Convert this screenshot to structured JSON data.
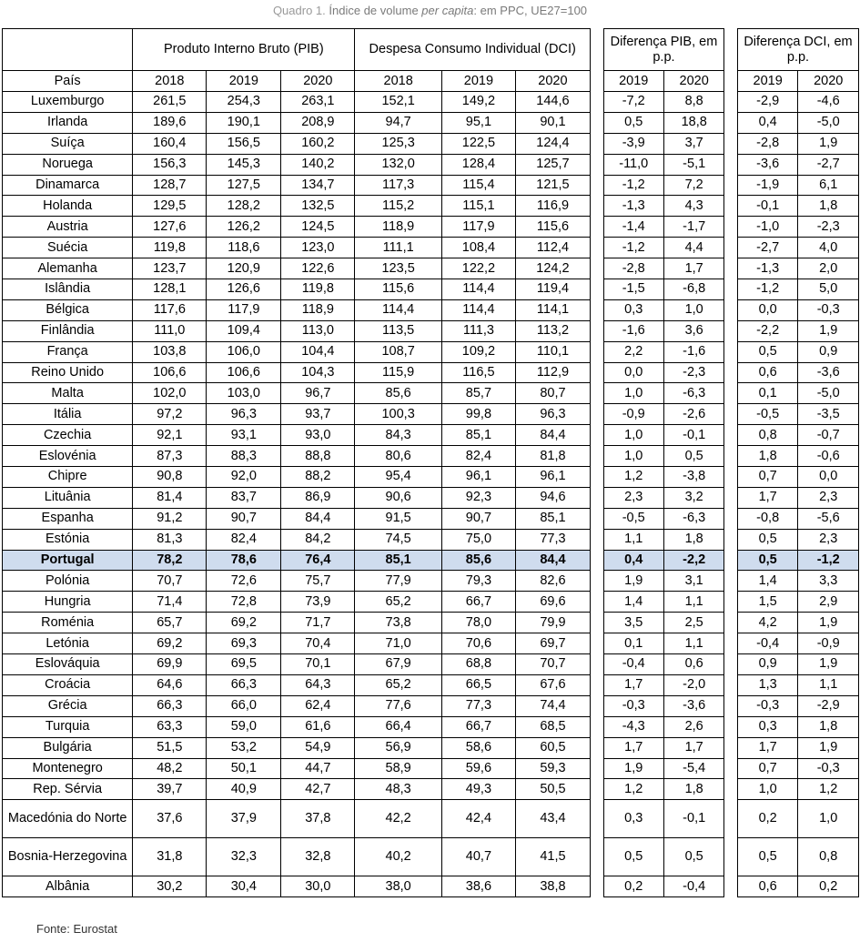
{
  "caption": {
    "label": "Quadro 1.",
    "text_a": "Índice de volume",
    "text_italic": "per capita",
    "text_b": ": em PPC, UE27=100"
  },
  "headers": {
    "pib": "Produto Interno Bruto (PIB)",
    "dci": "Despesa Consumo Individual (DCI)",
    "diff_pib": "Diferença PIB, em p.p.",
    "diff_dci": "Diferença DCI, em p.p.",
    "pais": "País",
    "y2018": "2018",
    "y2019": "2019",
    "y2020": "2020"
  },
  "rows": [
    [
      "Luxemburgo",
      "261,5",
      "254,3",
      "263,1",
      "152,1",
      "149,2",
      "144,6",
      "-7,2",
      "8,8",
      "-2,9",
      "-4,6"
    ],
    [
      "Irlanda",
      "189,6",
      "190,1",
      "208,9",
      "94,7",
      "95,1",
      "90,1",
      "0,5",
      "18,8",
      "0,4",
      "-5,0"
    ],
    [
      "Suíça",
      "160,4",
      "156,5",
      "160,2",
      "125,3",
      "122,5",
      "124,4",
      "-3,9",
      "3,7",
      "-2,8",
      "1,9"
    ],
    [
      "Noruega",
      "156,3",
      "145,3",
      "140,2",
      "132,0",
      "128,4",
      "125,7",
      "-11,0",
      "-5,1",
      "-3,6",
      "-2,7"
    ],
    [
      "Dinamarca",
      "128,7",
      "127,5",
      "134,7",
      "117,3",
      "115,4",
      "121,5",
      "-1,2",
      "7,2",
      "-1,9",
      "6,1"
    ],
    [
      "Holanda",
      "129,5",
      "128,2",
      "132,5",
      "115,2",
      "115,1",
      "116,9",
      "-1,3",
      "4,3",
      "-0,1",
      "1,8"
    ],
    [
      "Austria",
      "127,6",
      "126,2",
      "124,5",
      "118,9",
      "117,9",
      "115,6",
      "-1,4",
      "-1,7",
      "-1,0",
      "-2,3"
    ],
    [
      "Suécia",
      "119,8",
      "118,6",
      "123,0",
      "111,1",
      "108,4",
      "112,4",
      "-1,2",
      "4,4",
      "-2,7",
      "4,0"
    ],
    [
      "Alemanha",
      "123,7",
      "120,9",
      "122,6",
      "123,5",
      "122,2",
      "124,2",
      "-2,8",
      "1,7",
      "-1,3",
      "2,0"
    ],
    [
      "Islândia",
      "128,1",
      "126,6",
      "119,8",
      "115,6",
      "114,4",
      "119,4",
      "-1,5",
      "-6,8",
      "-1,2",
      "5,0"
    ],
    [
      "Bélgica",
      "117,6",
      "117,9",
      "118,9",
      "114,4",
      "114,4",
      "114,1",
      "0,3",
      "1,0",
      "0,0",
      "-0,3"
    ],
    [
      "Finlândia",
      "111,0",
      "109,4",
      "113,0",
      "113,5",
      "111,3",
      "113,2",
      "-1,6",
      "3,6",
      "-2,2",
      "1,9"
    ],
    [
      "França",
      "103,8",
      "106,0",
      "104,4",
      "108,7",
      "109,2",
      "110,1",
      "2,2",
      "-1,6",
      "0,5",
      "0,9"
    ],
    [
      "Reino Unido",
      "106,6",
      "106,6",
      "104,3",
      "115,9",
      "116,5",
      "112,9",
      "0,0",
      "-2,3",
      "0,6",
      "-3,6"
    ],
    [
      "Malta",
      "102,0",
      "103,0",
      "96,7",
      "85,6",
      "85,7",
      "80,7",
      "1,0",
      "-6,3",
      "0,1",
      "-5,0"
    ],
    [
      "Itália",
      "97,2",
      "96,3",
      "93,7",
      "100,3",
      "99,8",
      "96,3",
      "-0,9",
      "-2,6",
      "-0,5",
      "-3,5"
    ],
    [
      "Czechia",
      "92,1",
      "93,1",
      "93,0",
      "84,3",
      "85,1",
      "84,4",
      "1,0",
      "-0,1",
      "0,8",
      "-0,7"
    ],
    [
      "Eslovénia",
      "87,3",
      "88,3",
      "88,8",
      "80,6",
      "82,4",
      "81,8",
      "1,0",
      "0,5",
      "1,8",
      "-0,6"
    ],
    [
      "Chipre",
      "90,8",
      "92,0",
      "88,2",
      "95,4",
      "96,1",
      "96,1",
      "1,2",
      "-3,8",
      "0,7",
      "0,0"
    ],
    [
      "Lituânia",
      "81,4",
      "83,7",
      "86,9",
      "90,6",
      "92,3",
      "94,6",
      "2,3",
      "3,2",
      "1,7",
      "2,3"
    ],
    [
      "Espanha",
      "91,2",
      "90,7",
      "84,4",
      "91,5",
      "90,7",
      "85,1",
      "-0,5",
      "-6,3",
      "-0,8",
      "-5,6"
    ],
    [
      "Estónia",
      "81,3",
      "82,4",
      "84,2",
      "74,5",
      "75,0",
      "77,3",
      "1,1",
      "1,8",
      "0,5",
      "2,3"
    ],
    [
      "Portugal",
      "78,2",
      "78,6",
      "76,4",
      "85,1",
      "85,6",
      "84,4",
      "0,4",
      "-2,2",
      "0,5",
      "-1,2"
    ],
    [
      "Polónia",
      "70,7",
      "72,6",
      "75,7",
      "77,9",
      "79,3",
      "82,6",
      "1,9",
      "3,1",
      "1,4",
      "3,3"
    ],
    [
      "Hungria",
      "71,4",
      "72,8",
      "73,9",
      "65,2",
      "66,7",
      "69,6",
      "1,4",
      "1,1",
      "1,5",
      "2,9"
    ],
    [
      "Roménia",
      "65,7",
      "69,2",
      "71,7",
      "73,8",
      "78,0",
      "79,9",
      "3,5",
      "2,5",
      "4,2",
      "1,9"
    ],
    [
      "Letónia",
      "69,2",
      "69,3",
      "70,4",
      "71,0",
      "70,6",
      "69,7",
      "0,1",
      "1,1",
      "-0,4",
      "-0,9"
    ],
    [
      "Eslováquia",
      "69,9",
      "69,5",
      "70,1",
      "67,9",
      "68,8",
      "70,7",
      "-0,4",
      "0,6",
      "0,9",
      "1,9"
    ],
    [
      "Croácia",
      "64,6",
      "66,3",
      "64,3",
      "65,2",
      "66,5",
      "67,6",
      "1,7",
      "-2,0",
      "1,3",
      "1,1"
    ],
    [
      "Grécia",
      "66,3",
      "66,0",
      "62,4",
      "77,6",
      "77,3",
      "74,4",
      "-0,3",
      "-3,6",
      "-0,3",
      "-2,9"
    ],
    [
      "Turquia",
      "63,3",
      "59,0",
      "61,6",
      "66,4",
      "66,7",
      "68,5",
      "-4,3",
      "2,6",
      "0,3",
      "1,8"
    ],
    [
      "Bulgária",
      "51,5",
      "53,2",
      "54,9",
      "56,9",
      "58,6",
      "60,5",
      "1,7",
      "1,7",
      "1,7",
      "1,9"
    ],
    [
      "Montenegro",
      "48,2",
      "50,1",
      "44,7",
      "58,9",
      "59,6",
      "59,3",
      "1,9",
      "-5,4",
      "0,7",
      "-0,3"
    ],
    [
      "Rep. Sérvia",
      "39,7",
      "40,9",
      "42,7",
      "48,3",
      "49,3",
      "50,5",
      "1,2",
      "1,8",
      "1,0",
      "1,2"
    ],
    [
      "Macedónia do Norte",
      "37,6",
      "37,9",
      "37,8",
      "42,2",
      "42,4",
      "43,4",
      "0,3",
      "-0,1",
      "0,2",
      "1,0"
    ],
    [
      "Bosnia-Herzegovina",
      "31,8",
      "32,3",
      "32,8",
      "40,2",
      "40,7",
      "41,5",
      "0,5",
      "0,5",
      "0,5",
      "0,8"
    ],
    [
      "Albânia",
      "30,2",
      "30,4",
      "30,0",
      "38,0",
      "38,6",
      "38,8",
      "0,2",
      "-0,4",
      "0,6",
      "0,2"
    ]
  ],
  "highlight_row": "Portugal",
  "highlight_color": "#cfdcee",
  "source": "Fonte: Eurostat"
}
